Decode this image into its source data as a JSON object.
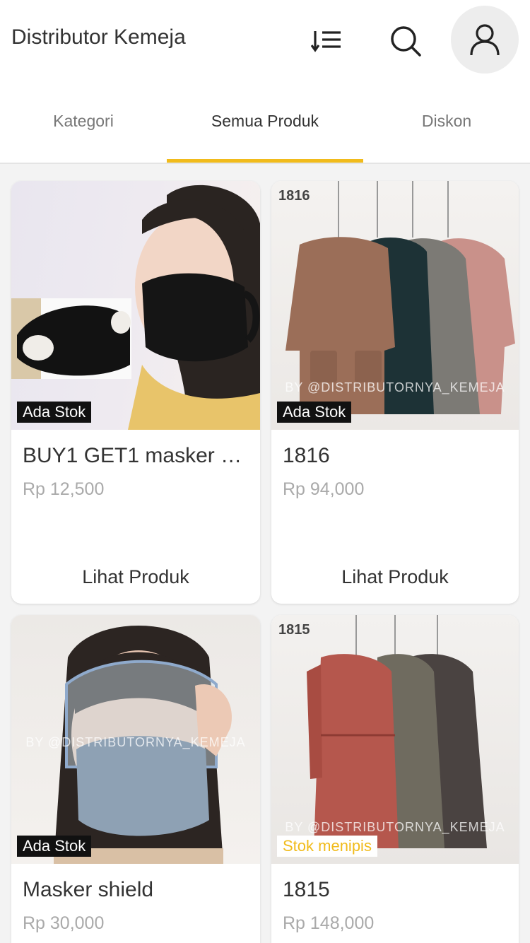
{
  "app": {
    "title": "Distributor Kemeja"
  },
  "header": {
    "sort_icon": "sort-descending-list-icon",
    "search_icon": "search-icon",
    "profile_icon": "user-icon"
  },
  "tabs": [
    {
      "label": "Kategori",
      "active": false
    },
    {
      "label": "Semua Produk",
      "active": true
    },
    {
      "label": "Diskon",
      "active": false
    }
  ],
  "accent_color": "#f1bb1b",
  "products": [
    {
      "name": "BUY1 GET1 masker …",
      "price": "Rp 12,500",
      "stock": "Ada Stok",
      "cta": "Lihat Produk"
    },
    {
      "name": "1816",
      "price": "Rp 94,000",
      "stock": "Ada Stok",
      "cta": "Lihat Produk",
      "image_code": "1816",
      "watermark": "BY @DISTRIBUTORNYA_KEMEJA"
    },
    {
      "name": "Masker shield",
      "price": "Rp 30,000",
      "stock": "Ada Stok",
      "watermark": "BY @DISTRIBUTORNYA_KEMEJA"
    },
    {
      "name": "1815",
      "price": "Rp 148,000",
      "stock": "Stok menipis",
      "image_code": "1815",
      "watermark": "BY @DISTRIBUTORNYA_KEMEJA"
    }
  ]
}
